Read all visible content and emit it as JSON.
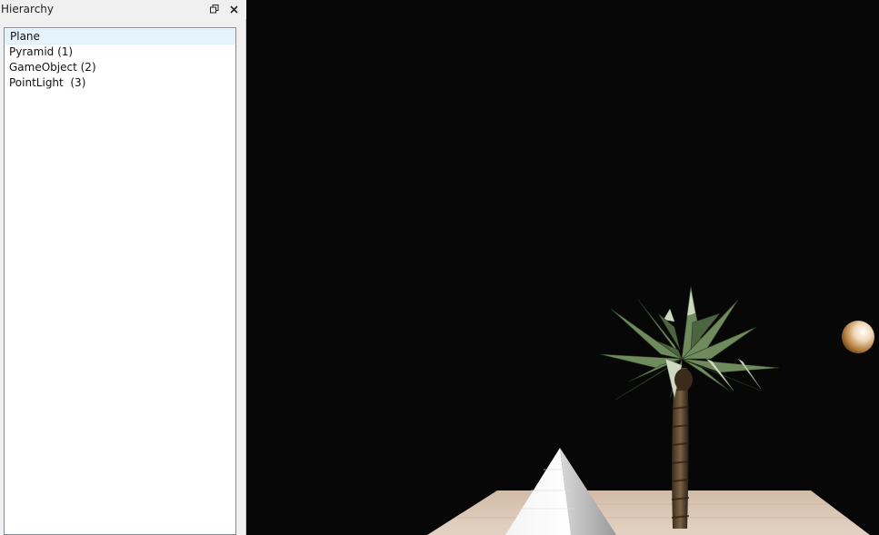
{
  "panel": {
    "title": "Hierarchy",
    "restore_icon": "restore-window-icon",
    "close_icon": "close-icon",
    "items": [
      {
        "label": "Plane",
        "selected": true
      },
      {
        "label": "Pyramid (1)",
        "selected": false
      },
      {
        "label": "GameObject (2)",
        "selected": false
      },
      {
        "label": "PointLight  (3)",
        "selected": false
      }
    ]
  },
  "viewport": {
    "background": "#070707",
    "objects": [
      "plane",
      "pyramid",
      "palm-tree",
      "sphere"
    ]
  }
}
